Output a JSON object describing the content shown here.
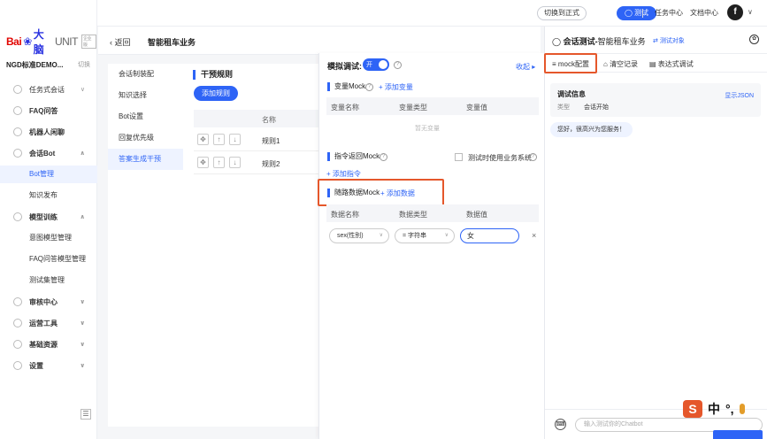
{
  "topbar": {
    "switch_formal": "切换到正式",
    "test_button": "测试",
    "task_center": "任务中心",
    "doc_center": "文档中心",
    "avatar_letter": "f"
  },
  "sidebar": {
    "logo_bai": "Bai",
    "logo_du": "大脑",
    "logo_unit": "UNIT",
    "logo_badge": "企业版",
    "workspace": "NGD标准DEMO...",
    "switch_label": "切换",
    "items": [
      {
        "label": "任务式会话",
        "icon": "task-icon"
      },
      {
        "label": "FAQ问答",
        "icon": "faq-icon"
      },
      {
        "label": "机器人闲聊",
        "icon": "chat-icon"
      },
      {
        "label": "会话Bot",
        "icon": "bot-icon"
      },
      {
        "label": "Bot管理",
        "sub": true,
        "active": true
      },
      {
        "label": "知识发布",
        "sub": true
      },
      {
        "label": "模型训练",
        "icon": "model-icon"
      },
      {
        "label": "意图模型管理",
        "sub": true
      },
      {
        "label": "FAQ问答模型管理",
        "sub": true
      },
      {
        "label": "测试集管理",
        "sub": true
      },
      {
        "label": "审核中心",
        "icon": "audit-icon"
      },
      {
        "label": "运营工具",
        "icon": "tool-icon"
      },
      {
        "label": "基础资源",
        "icon": "resource-icon"
      },
      {
        "label": "设置",
        "icon": "settings-icon"
      }
    ]
  },
  "page": {
    "back": "返回",
    "title": "智能租车业务"
  },
  "settings_menu": [
    "会话制装配",
    "知识选择",
    "Bot设置",
    "回复优先级",
    "答案生成干预"
  ],
  "rules": {
    "section_title": "干预规则",
    "add_button": "添加规则",
    "col_name": "名称",
    "rows": [
      "规则1",
      "规则2"
    ]
  },
  "mock": {
    "title": "模拟调试:",
    "toggle_label": "开",
    "collapse": "收起",
    "var_mock": {
      "title": "变量Mock",
      "add": "添加变量",
      "columns": [
        "变量名称",
        "变量类型",
        "变量值"
      ],
      "empty": "暂无变量"
    },
    "cmd_mock": {
      "title": "指令返回Mock",
      "check_label": "测试时使用业务系统",
      "add": "添加指令"
    },
    "route_mock": {
      "title": "随路数据Mock",
      "add": "添加数据",
      "columns": [
        "数据名称",
        "数据类型",
        "数据值"
      ],
      "row": {
        "name": "sex(性别)",
        "type": "= 字符串",
        "value": "女"
      }
    }
  },
  "chat": {
    "title_prefix": "会话测试-",
    "title_bot": "智能租车业务",
    "test_object": "测试对象",
    "tabs": [
      "mock配置",
      "清空记录",
      "表达式调试"
    ],
    "debug_title": "调试信息",
    "show_json": "显示JSON",
    "debug_key": "类型",
    "debug_value": "会话开始",
    "greeting": "您好，很高兴为您服务！",
    "input_placeholder": "输入测试你的Chatbot"
  },
  "ime": {
    "s": "S",
    "zh": "中",
    "punct": "°,"
  },
  "colors": {
    "accent": "#2e64f6",
    "highlight": "#e5572b"
  }
}
